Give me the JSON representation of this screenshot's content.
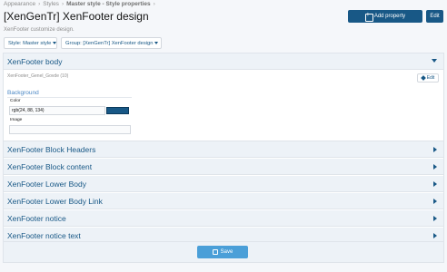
{
  "breadcrumb": {
    "items": [
      "Appearance",
      "Styles",
      "Master style - Style properties"
    ]
  },
  "header": {
    "title": "[XenGenTr] XenFooter design",
    "description": "XenFooter customize design.",
    "add_property_label": "Add property",
    "edit_label": "Edit"
  },
  "filters": {
    "style_label": "Style: Master style",
    "group_label": "Group: [XenGenTr] XenFooter design"
  },
  "sections": [
    {
      "label": "XenFooter body",
      "expanded": true
    },
    {
      "label": "XenFooter Block Headers",
      "expanded": false
    },
    {
      "label": "XenFooter Block content",
      "expanded": false
    },
    {
      "label": "XenFooter Lower Body",
      "expanded": false
    },
    {
      "label": "XenFooter Lower Body Link",
      "expanded": false
    },
    {
      "label": "XenFooter notice",
      "expanded": false
    },
    {
      "label": "XenFooter notice text",
      "expanded": false
    }
  ],
  "body_panel": {
    "property_name": "XenFooter_Genel_Govde (10)",
    "edit_label": "Edit",
    "group_title": "Background",
    "color_label": "Color",
    "color_value": "rgb(24, 88, 134)",
    "swatch_color": "#185886",
    "image_label": "Image",
    "image_value": ""
  },
  "footer": {
    "save_label": "Save"
  },
  "colors": {
    "accent": "#185886",
    "save_button": "#4a9fd8",
    "section_header_bg": "#edf2f7"
  }
}
